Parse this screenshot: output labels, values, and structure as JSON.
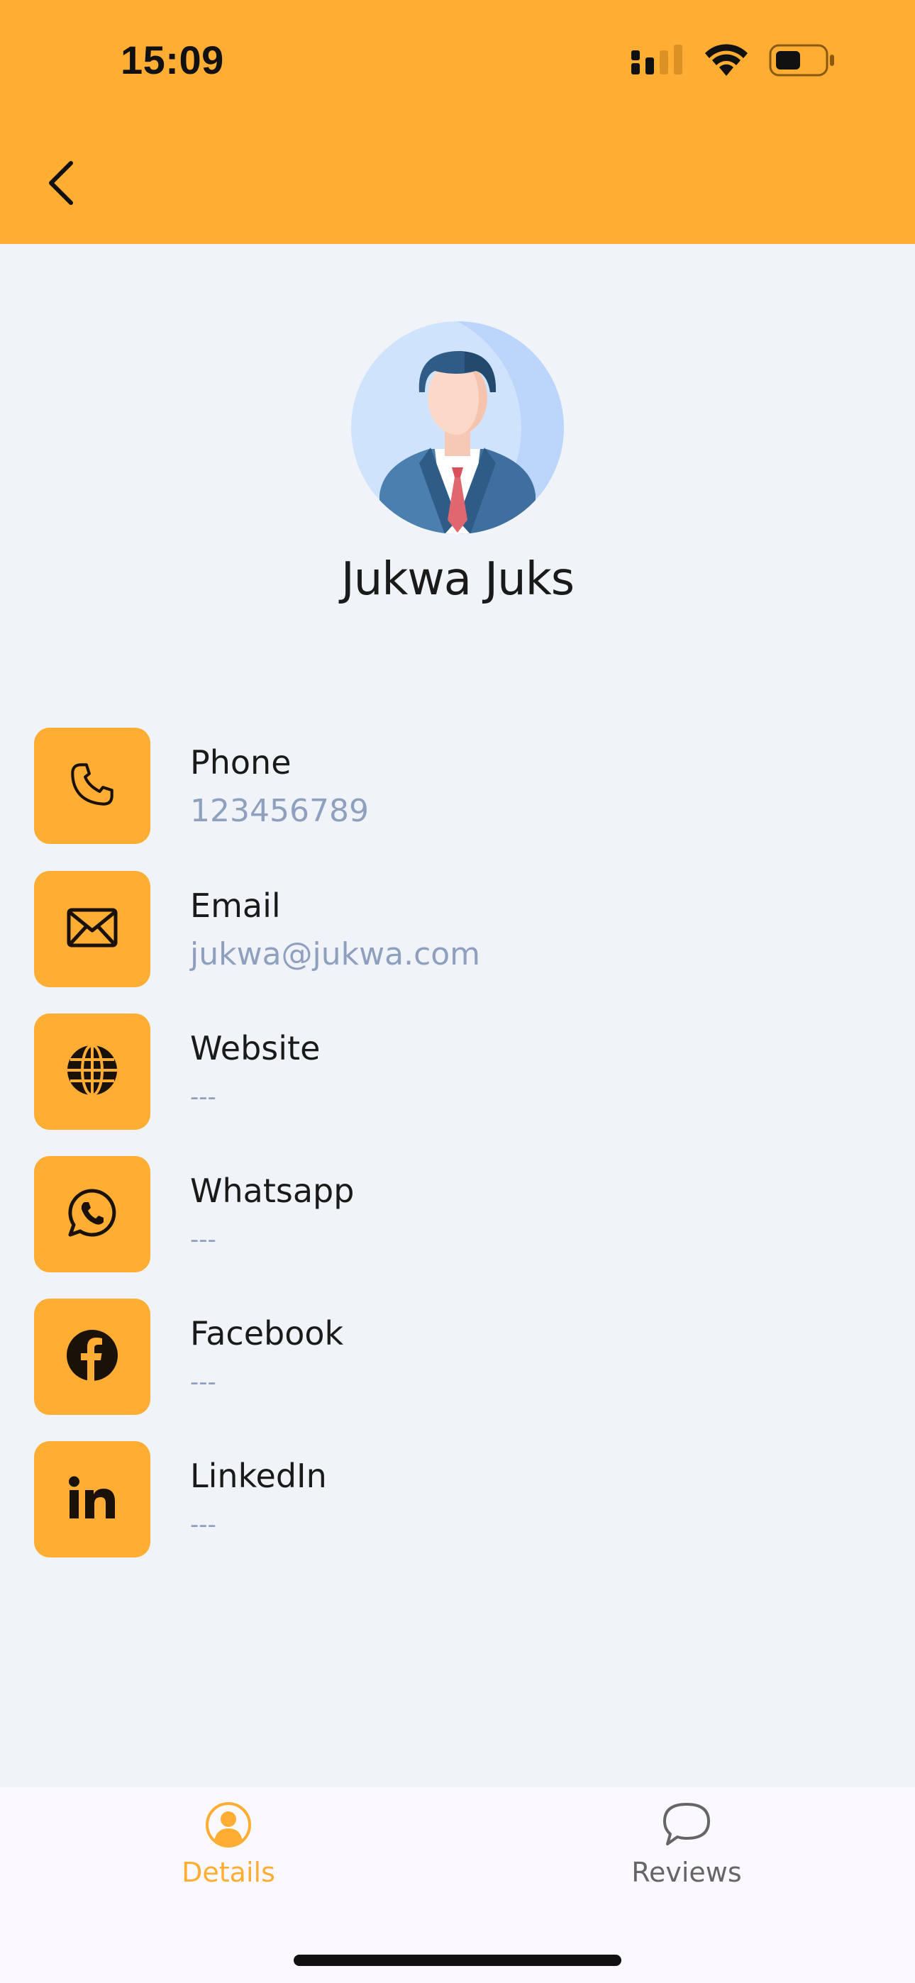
{
  "status_bar": {
    "time": "15:09",
    "signal_icon": "cellular-signal-icon",
    "wifi_icon": "wifi-icon",
    "battery_icon": "battery-icon"
  },
  "header": {
    "back_icon": "chevron-left-icon",
    "background_color": "#FFAD33"
  },
  "profile": {
    "name": "Jukwa Juks",
    "avatar_icon": "businessman-avatar-icon"
  },
  "contacts": [
    {
      "label": "Phone",
      "value": "123456789",
      "icon": "phone-icon"
    },
    {
      "label": "Email",
      "value": "jukwa@jukwa.com",
      "icon": "envelope-icon"
    },
    {
      "label": "Website",
      "value": "---",
      "icon": "globe-icon"
    },
    {
      "label": "Whatsapp",
      "value": "---",
      "icon": "whatsapp-icon"
    },
    {
      "label": "Facebook",
      "value": "---",
      "icon": "facebook-icon"
    },
    {
      "label": "LinkedIn",
      "value": "---",
      "icon": "linkedin-icon"
    }
  ],
  "tabbar": {
    "tabs": [
      {
        "label": "Details",
        "icon": "person-icon",
        "active": true
      },
      {
        "label": "Reviews",
        "icon": "chat-bubble-icon",
        "active": false
      }
    ],
    "active_color": "#FFAD33",
    "inactive_color": "#666666"
  },
  "colors": {
    "accent": "#FFAD33",
    "background": "#F0F4F8",
    "value_text": "#8FA0BF"
  }
}
